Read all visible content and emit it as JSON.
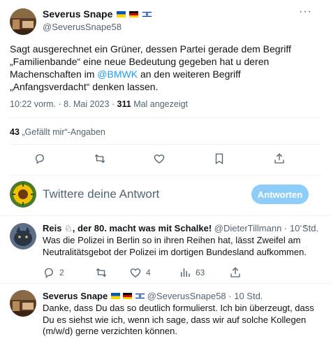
{
  "main_tweet": {
    "author_name": "Severus Snape",
    "handle": "@SeverusSnape58",
    "text_before_link": "Sagt ausgerechnet ein Grüner, dessen Partei gerade dem Begriff „Familienbande“ eine neue Bedeutung gegeben hat u deren Machenschaften im ",
    "link_text": "@BMWK",
    "text_after_link": " an den weiteren Begriff „Anfangsverdacht“ denken lassen.",
    "time": "10:22 vorm. · 8. Mai 2023 · ",
    "views_count": "311",
    "views_label": " Mal angezeigt",
    "likes_count": "43",
    "likes_label": " „Gefällt mir“-Angaben"
  },
  "reply_box": {
    "placeholder": "Twittere deine Antwort",
    "button_label": "Antworten"
  },
  "replies": [
    {
      "author_name": "Reis ♘, der 80. macht was mit Schalke!",
      "handle": "@DieterTillmann",
      "time": " · 10 Std.",
      "text": "Was die Polizei in Berlin so in ihren Reihen hat, lässt Zweifel am Neutralitätsgebot der Polizei im dortigen Bundesland aufkommen.",
      "reply_count": "2",
      "retweet_count": "",
      "like_count": "4",
      "view_count": "63"
    },
    {
      "author_name": "Severus Snape",
      "handle": "@SeverusSnape58",
      "time": " · 10 Std.",
      "text": "Danke, dass Du das so deutlich formulierst. Ich bin überzeugt, dass Du es siehst wie ich, wenn ich sage, dass wir auf solche Kollegen (m/w/d) gerne verzichten können."
    }
  ],
  "colors": {
    "accent": "#1d9bf0",
    "muted": "#536471",
    "button_disabled": "#8ecdf8"
  },
  "icons": [
    "ukraine-flag-icon",
    "germany-flag-icon",
    "israel-flag-icon",
    "more-icon",
    "reply-icon",
    "retweet-icon",
    "like-icon",
    "bookmark-icon",
    "share-icon",
    "views-icon"
  ]
}
